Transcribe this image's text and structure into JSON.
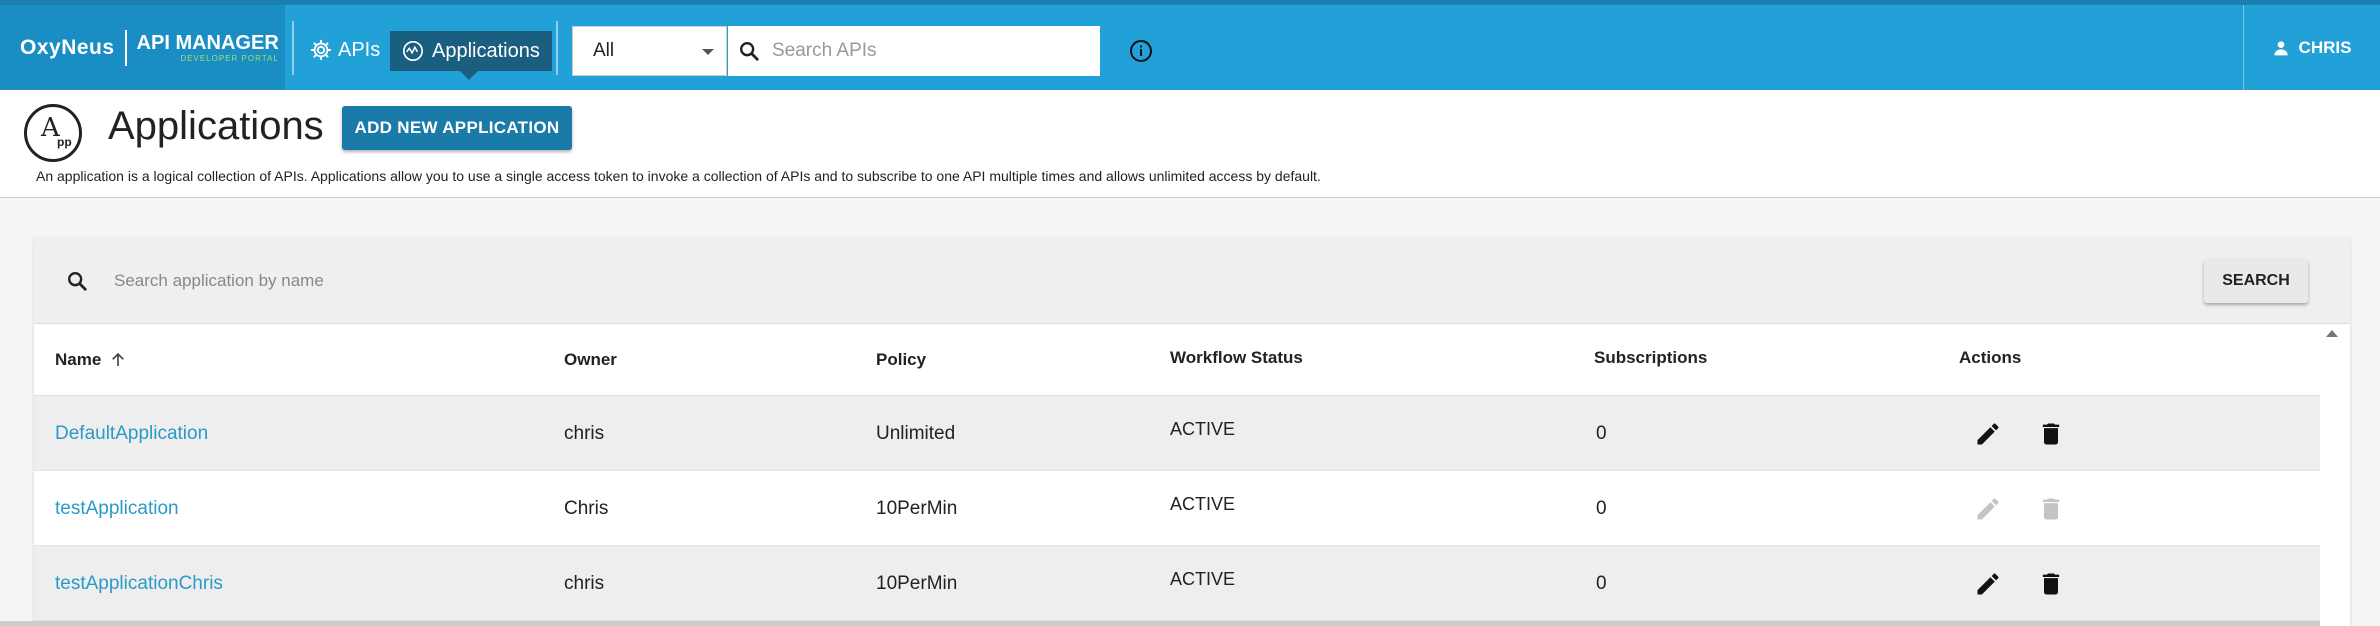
{
  "topbar": {
    "brand": "OxyNeus",
    "product_title": "API MANAGER",
    "product_subtitle": "DEVELOPER PORTAL",
    "nav_apis": "APIs",
    "nav_applications": "Applications",
    "filter_value": "All",
    "search_placeholder": "Search APIs",
    "user_name": "CHRIS"
  },
  "header": {
    "logo_letter": "A",
    "logo_sub": "pp",
    "title": "Applications",
    "add_button": "ADD NEW APPLICATION",
    "description": "An application is a logical collection of APIs. Applications allow you to use a single access token to invoke a collection of APIs and to subscribe to one API multiple times and allows unlimited access by default."
  },
  "app_search": {
    "placeholder": "Search application by name",
    "button": "SEARCH"
  },
  "table": {
    "columns": {
      "name": "Name",
      "owner": "Owner",
      "policy": "Policy",
      "workflow": "Workflow Status",
      "subscriptions": "Subscriptions",
      "actions": "Actions"
    },
    "rows": [
      {
        "name": "DefaultApplication",
        "owner": "chris",
        "policy": "Unlimited",
        "status": "ACTIVE",
        "subscriptions": "0",
        "actions_enabled": true
      },
      {
        "name": "testApplication",
        "owner": "Chris",
        "policy": "10PerMin",
        "status": "ACTIVE",
        "subscriptions": "0",
        "actions_enabled": false
      },
      {
        "name": "testApplicationChris",
        "owner": "chris",
        "policy": "10PerMin",
        "status": "ACTIVE",
        "subscriptions": "0",
        "actions_enabled": true
      }
    ]
  },
  "colors": {
    "topbar": "#22a1d8",
    "nav_active": "#1b5f80",
    "accent_button": "#1a7aa8",
    "link": "#2a9ac9",
    "brand_green": "#9de36e"
  },
  "icons": {
    "nav_apis": "gear-icon",
    "nav_applications": "applications-icon",
    "search": "search-icon",
    "info": "info-icon",
    "user": "user-icon",
    "sort": "arrow-up-icon",
    "edit": "pencil-icon",
    "delete": "trash-icon"
  }
}
